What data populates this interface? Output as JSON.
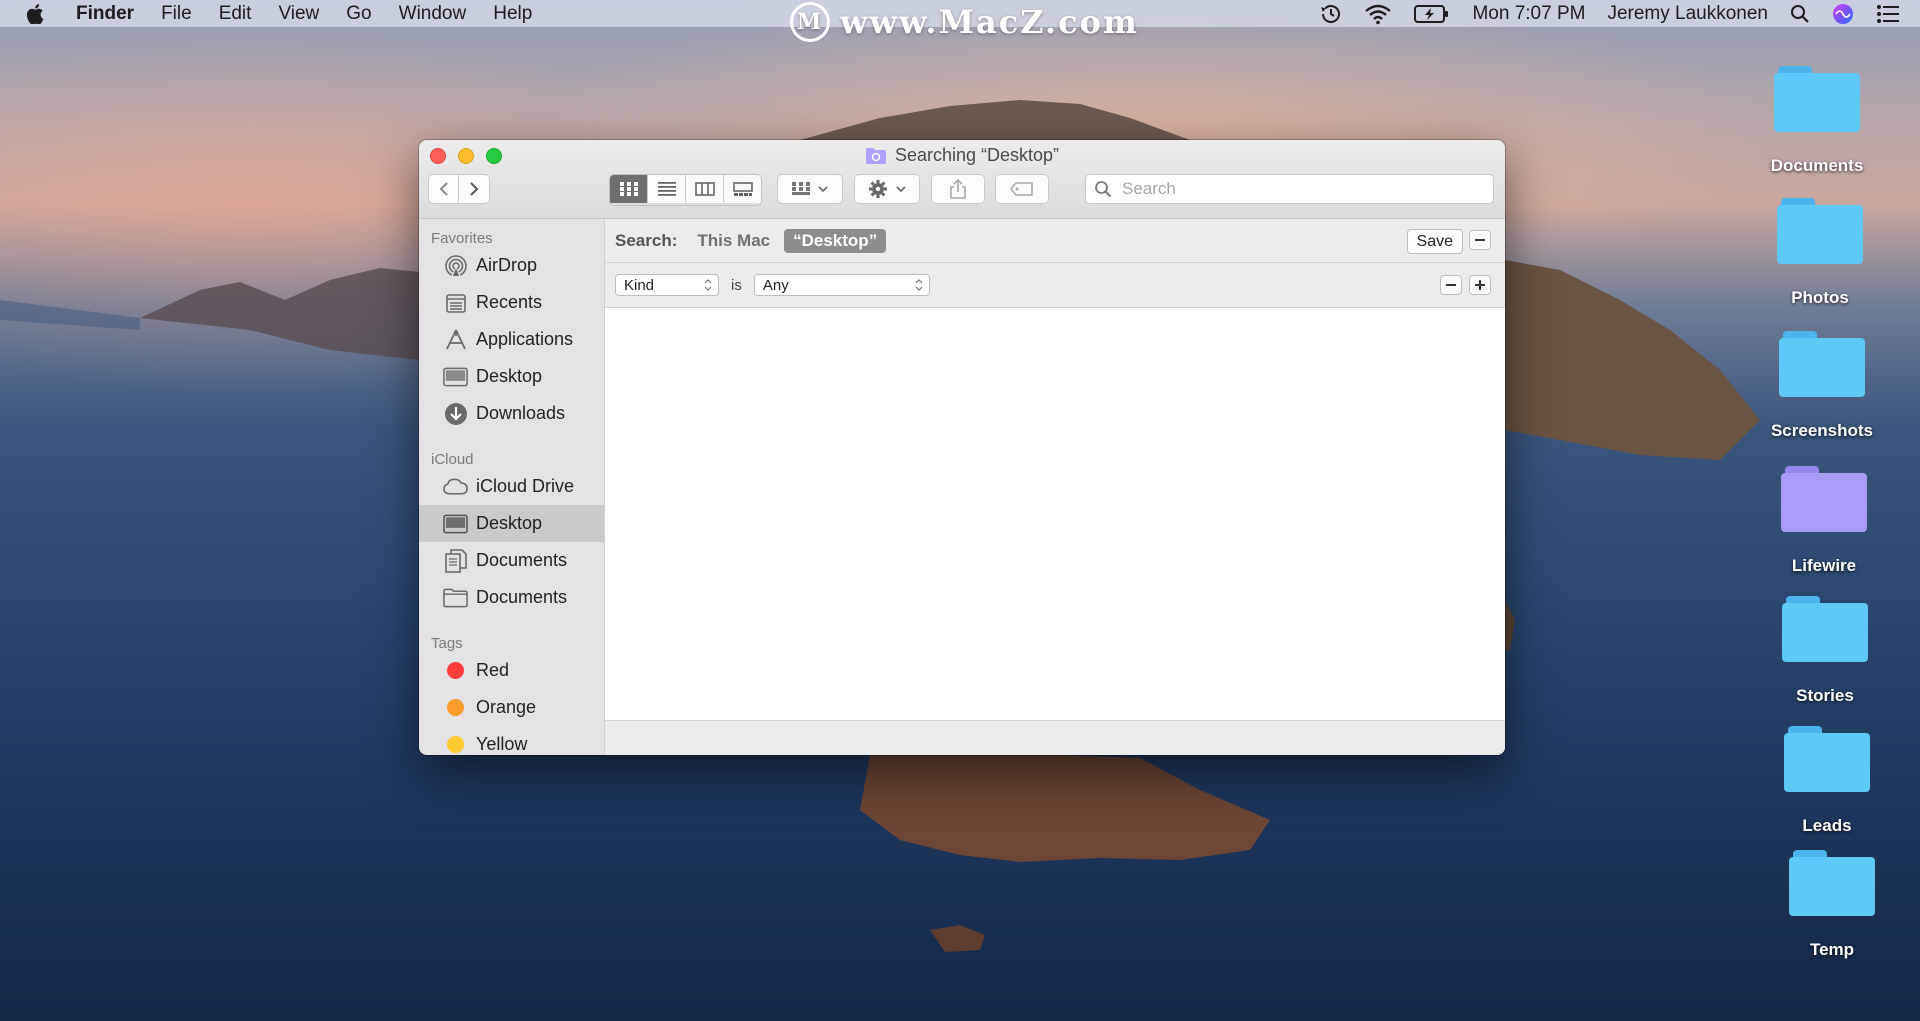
{
  "menubar": {
    "app_name": "Finder",
    "items": [
      "File",
      "Edit",
      "View",
      "Go",
      "Window",
      "Help"
    ],
    "clock": "Mon 7:07 PM",
    "user": "Jeremy Laukkonen",
    "watermark": "www.MacZ.com"
  },
  "window": {
    "title": "Searching “Desktop”",
    "search_placeholder": "Search",
    "view_modes": [
      "icon-view",
      "list-view",
      "column-view",
      "gallery-view"
    ],
    "active_view": "icon-view"
  },
  "sidebar": {
    "favorites_header": "Favorites",
    "favorites": [
      {
        "label": "AirDrop",
        "icon": "airdrop-icon"
      },
      {
        "label": "Recents",
        "icon": "recents-icon"
      },
      {
        "label": "Applications",
        "icon": "applications-icon"
      },
      {
        "label": "Desktop",
        "icon": "desktop-icon"
      },
      {
        "label": "Downloads",
        "icon": "downloads-icon"
      }
    ],
    "icloud_header": "iCloud",
    "icloud": [
      {
        "label": "iCloud Drive",
        "icon": "cloud-icon"
      },
      {
        "label": "Desktop",
        "icon": "desktop-icon",
        "selected": true
      },
      {
        "label": "Documents",
        "icon": "documents-icon"
      },
      {
        "label": "Documents",
        "icon": "folder-icon"
      }
    ],
    "tags_header": "Tags",
    "tags": [
      {
        "label": "Red",
        "color": "#fc3d39"
      },
      {
        "label": "Orange",
        "color": "#fd9a2c"
      },
      {
        "label": "Yellow",
        "color": "#fecb2f"
      }
    ]
  },
  "scope": {
    "label": "Search:",
    "this_mac": "This Mac",
    "current": "“Desktop”",
    "save": "Save"
  },
  "criteria": {
    "attribute": "Kind",
    "operator": "is",
    "value": "Any"
  },
  "desktop_icons": [
    {
      "label": "Documents",
      "color": "#5ec8f7"
    },
    {
      "label": "Photos",
      "color": "#5ec8f7"
    },
    {
      "label": "Screenshots",
      "color": "#5ec8f7"
    },
    {
      "label": "Lifewire",
      "color": "#a89cf5"
    },
    {
      "label": "Stories",
      "color": "#5ec8f7"
    },
    {
      "label": "Leads",
      "color": "#5ec8f7"
    },
    {
      "label": "Temp",
      "color": "#5ec8f7"
    }
  ]
}
